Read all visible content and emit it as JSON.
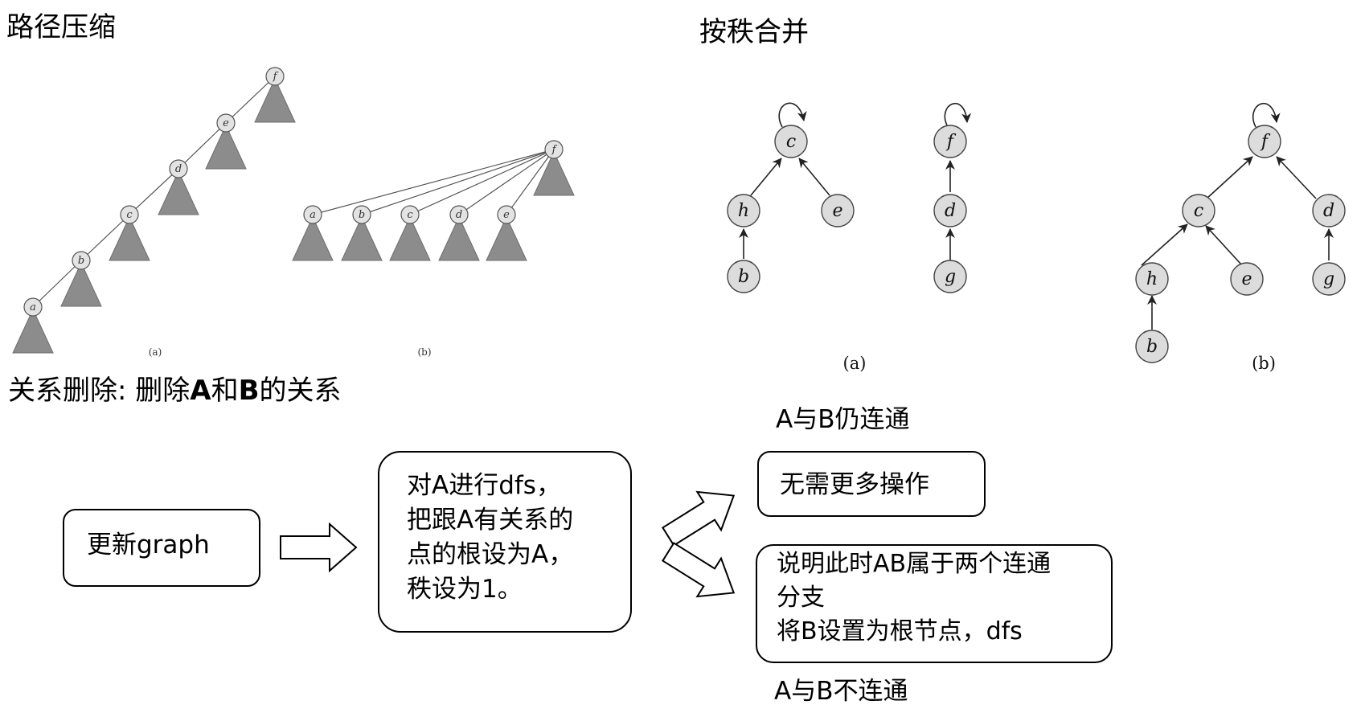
{
  "headings": {
    "path_compression": "路径压缩",
    "union_by_rank": "按秩合并",
    "delete_relation_prefix": "关系删除: 删除",
    "delete_relation_a": "A",
    "delete_relation_and": "和",
    "delete_relation_b": "B",
    "delete_relation_suffix": "的关系"
  },
  "path_compression": {
    "nodes_a": [
      "a",
      "b",
      "c",
      "d",
      "e",
      "f"
    ],
    "nodes_b_children": [
      "a",
      "b",
      "c",
      "d",
      "e"
    ],
    "root_b": "f",
    "caption_a": "(a)",
    "caption_b": "(b)"
  },
  "union_by_rank": {
    "fig_a": {
      "c": "c",
      "h": "h",
      "e": "e",
      "b": "b",
      "f": "f",
      "d": "d",
      "g": "g"
    },
    "fig_b": {
      "f": "f",
      "c": "c",
      "d": "d",
      "h": "h",
      "e": "e",
      "g": "g",
      "b": "b"
    },
    "caption_a": "(a)",
    "caption_b": "(b)"
  },
  "flow": {
    "update_graph": "更新graph",
    "dfs_lines": [
      "对A进行dfs，",
      "把跟A有关系的",
      "点的根设为A，",
      "秩设为1。"
    ],
    "connected_label": "A与B仍连通",
    "no_more_ops": "无需更多操作",
    "split_lines": [
      "说明此时AB属于两个连通",
      "分支",
      "将B设置为根节点，dfs"
    ],
    "not_connected_label": "A与B不连通"
  }
}
